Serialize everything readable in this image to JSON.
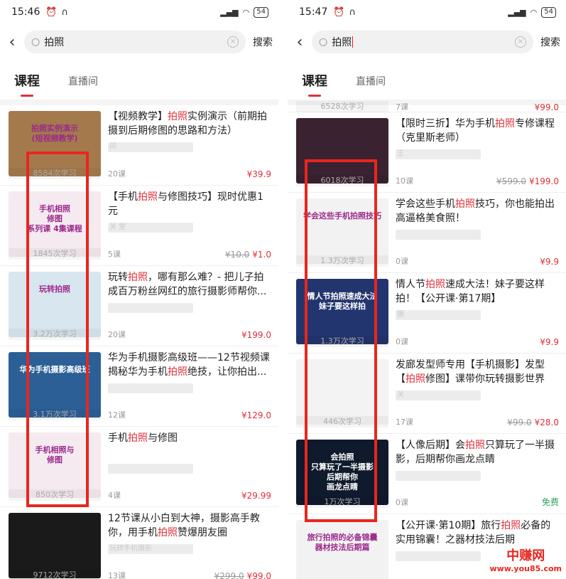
{
  "left": {
    "status": {
      "time": "15:46",
      "battery": "54"
    },
    "search": {
      "query": "拍照",
      "button": "搜索"
    },
    "tabs": [
      {
        "label": "课程"
      },
      {
        "label": "直播间"
      }
    ],
    "items": [
      {
        "title_pre": "【视频教学】",
        "title_hl": "拍照",
        "title_post": "实例演示（前期拍摄到后期修图的思路和方法）",
        "author": "间",
        "learners": "8584次学习",
        "lessons": "20课",
        "old_price": "",
        "price": "¥39.9",
        "thumb_text": "拍照实例演示\n(短视频教学)",
        "thumb_color": "#a47a4c"
      },
      {
        "title_pre": "【手机",
        "title_hl": "拍照",
        "title_post": "与修图技巧】现时优惠1元",
        "author": "关                      堂",
        "learners": "1845次学习",
        "lessons": "5课",
        "old_price": "¥10.0",
        "price": "¥1.0",
        "thumb_text": "手机相照\n修图\n系列课 4集课程",
        "thumb_color": "#f4eaf0"
      },
      {
        "title_pre": "玩转",
        "title_hl": "拍照",
        "title_post": "，哪有那么难？- 把儿子拍成百万粉丝网红的旅行摄影师帮你...",
        "author": "",
        "learners": "3.2万次学习",
        "lessons": "20课",
        "old_price": "",
        "price": "¥199.0",
        "thumb_text": "玩转拍照",
        "thumb_color": "#d8e6ef"
      },
      {
        "title_pre": "华为手机摄影高级班——12节视频课揭秘华为手机",
        "title_hl": "拍照",
        "title_post": "绝技，让你拍出...",
        "author": "",
        "learners": "3.1万次学习",
        "lessons": "12课",
        "old_price": "",
        "price": "¥129.0",
        "thumb_text": "华为手机摄影高级班",
        "thumb_color": "#2b5f96"
      },
      {
        "title_pre": "手机",
        "title_hl": "拍照",
        "title_post": "与修图",
        "author": "",
        "learners": "850次学习",
        "lessons": "4课",
        "old_price": "",
        "price": "¥29.99",
        "thumb_text": "手机相照与\n修图",
        "thumb_color": "#f4eaf0"
      },
      {
        "title_pre": "12节课从小白到大神，摄影高手教你，用手机",
        "title_hl": "拍照",
        "title_post": "赞爆朋友圈",
        "author": "玩转手机摄影",
        "learners": "9712次学习",
        "lessons": "13课",
        "old_price": "¥299.0",
        "price": "¥99.0",
        "thumb_text": "",
        "thumb_color": "#1a1a1a"
      }
    ]
  },
  "right": {
    "status": {
      "time": "15:47",
      "battery": "54"
    },
    "search": {
      "query": "拍照",
      "button": "搜索"
    },
    "tabs": [
      {
        "label": "课程"
      },
      {
        "label": "直播间"
      }
    ],
    "partial": {
      "learners": "6528次学习",
      "lessons": "7课",
      "price": "¥99.0"
    },
    "items": [
      {
        "title_pre": "【限时三折】华为手机",
        "title_hl": "拍照",
        "title_post": "专修课程（克里斯老师）",
        "author": "王",
        "learners": "6018次学习",
        "lessons": "10课",
        "old_price": "¥599.0",
        "price": "¥199.0",
        "thumb_text": "",
        "thumb_color": "#3a2230"
      },
      {
        "title_pre": "学会这些手机",
        "title_hl": "拍照",
        "title_post": "技巧，你也能拍出高逼格美食照！",
        "author": "",
        "learners": "1.3万次学习",
        "lessons": "0课",
        "old_price": "",
        "price": "¥9.9",
        "thumb_text": "学会这些手机拍照技巧",
        "thumb_color": "#f2f2f2"
      },
      {
        "title_pre": "情人节",
        "title_hl": "拍照",
        "title_post": "速成大法！妹子要这样拍！【公开课·第17期】",
        "author": "摄",
        "learners": "1.3万次学习",
        "lessons": "0课",
        "old_price": "",
        "price": "¥9.9",
        "thumb_text": "情人节拍照速成大法\n妹子要这样拍",
        "thumb_color": "#23356e"
      },
      {
        "title_pre": "发廊发型师专用【手机摄影】发型【",
        "title_hl": "拍照",
        "title_post": "修图】课带你玩转摄影世界",
        "author": "关",
        "learners": "446次学习",
        "lessons": "17课",
        "old_price": "¥99.0",
        "price": "¥28.0",
        "thumb_text": "",
        "thumb_color": "#f3f3f3"
      },
      {
        "title_pre": "【人像后期】会",
        "title_hl": "拍照",
        "title_post": "只算玩了一半摄影，后期帮你画龙点睛",
        "author": "",
        "learners": "1万次学习",
        "lessons": "0课",
        "old_price": "",
        "price": "免费",
        "thumb_text": "会拍照\n只算玩了一半摄影\n后期帮你\n画龙点睛",
        "thumb_color": "#0f1a2c"
      },
      {
        "title_pre": "【公开课·第10期】旅行",
        "title_hl": "拍照",
        "title_post": "必备的实用锦囊！之器材技法后期",
        "author": "",
        "learners": "",
        "lessons": "",
        "old_price": "",
        "price": "",
        "thumb_text": "旅行拍照的必备锦囊\n器材技法后期篇",
        "thumb_color": "#f2f2f2"
      }
    ]
  },
  "watermark": {
    "line1": "中赚网",
    "line2": "www.you85.com"
  }
}
